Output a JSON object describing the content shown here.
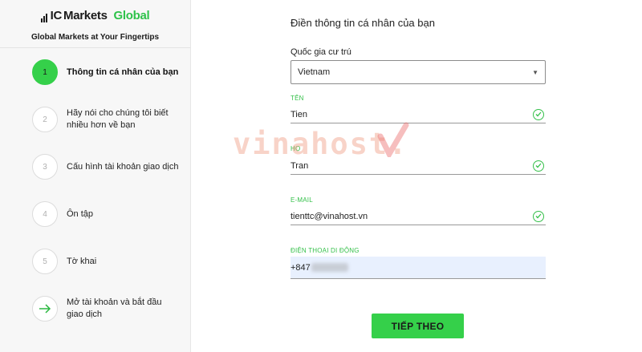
{
  "brand": {
    "logo_ic": "IC",
    "logo_markets": "Markets",
    "logo_global": "Global",
    "tagline": "Global Markets at Your Fingertips"
  },
  "steps": [
    {
      "number": "1",
      "label": "Thông tin cá nhân của bạn",
      "active": true
    },
    {
      "number": "2",
      "label": "Hãy nói cho chúng tôi biết nhiều hơn về bạn",
      "active": false
    },
    {
      "number": "3",
      "label": "Cấu hình tài khoản giao dịch",
      "active": false
    },
    {
      "number": "4",
      "label": "Ôn tập",
      "active": false
    },
    {
      "number": "5",
      "label": "Tờ khai",
      "active": false
    },
    {
      "number": "",
      "label": "Mở tài khoản và bắt đầu giao dịch",
      "icon": "arrow-right-icon",
      "active": false
    }
  ],
  "form": {
    "title": "Điền thông tin cá nhân của bạn",
    "country_label": "Quốc gia cư trú",
    "country_value": "Vietnam",
    "first_name_label": "TÊN",
    "first_name_value": "Tien",
    "last_name_label": "HỌ",
    "last_name_value": "Tran",
    "email_label": "E-MAIL",
    "email_value": "tienttc@vinahost.vn",
    "phone_label": "ĐIỆN THOẠI DI ĐỘNG",
    "phone_value": "+847"
  },
  "submit_label": "TIẾP THEO",
  "watermark": "vinahost.",
  "colors": {
    "accent": "#35d04a",
    "label_green": "#35c04a",
    "sidebar_bg": "#f7f7f7",
    "phone_bg": "#e8f0fe"
  }
}
